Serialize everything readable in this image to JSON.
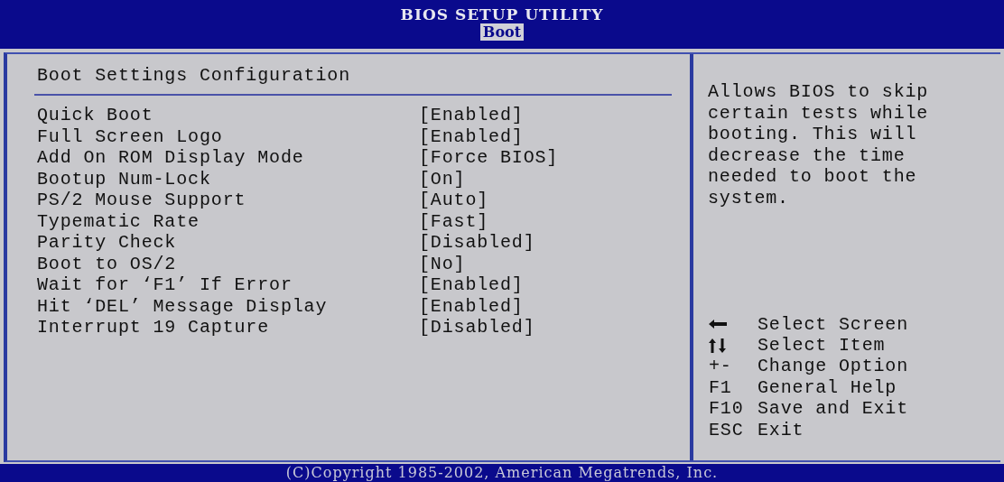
{
  "header": {
    "title": "BIOS SETUP UTILITY",
    "tabs": [
      {
        "label": "Boot",
        "selected": true
      }
    ]
  },
  "settings": {
    "title": "Boot Settings Configuration",
    "items": [
      {
        "label": "Quick Boot",
        "value": "[Enabled]"
      },
      {
        "label": "Full Screen Logo",
        "value": "[Enabled]"
      },
      {
        "label": "Add On ROM Display Mode",
        "value": "[Force BIOS]"
      },
      {
        "label": "Bootup Num-Lock",
        "value": "[On]"
      },
      {
        "label": "PS/2 Mouse Support",
        "value": "[Auto]"
      },
      {
        "label": "Typematic Rate",
        "value": "[Fast]"
      },
      {
        "label": "Parity Check",
        "value": "[Disabled]"
      },
      {
        "label": "Boot to OS/2",
        "value": "[No]"
      },
      {
        "label": "Wait for ‘F1’ If Error",
        "value": "[Enabled]"
      },
      {
        "label": "Hit ‘DEL’ Message Display",
        "value": "[Enabled]"
      },
      {
        "label": "Interrupt 19 Capture",
        "value": "[Disabled]"
      }
    ]
  },
  "help": {
    "text": "Allows BIOS to skip certain tests while booting. This will decrease the time needed to boot the system.",
    "legend": [
      {
        "kind": "horizontal",
        "action": "Select Screen"
      },
      {
        "kind": "vertical",
        "action": "Select Item"
      },
      {
        "kind": "text",
        "key": "+-",
        "action": "Change Option"
      },
      {
        "kind": "text",
        "key": "F1",
        "action": "General Help"
      },
      {
        "kind": "text",
        "key": "F10",
        "action": "Save and Exit"
      },
      {
        "kind": "text",
        "key": "ESC",
        "action": "Exit"
      }
    ]
  },
  "footer": {
    "text": "(C)Copyright 1985-2002, American Megatrends, Inc."
  }
}
